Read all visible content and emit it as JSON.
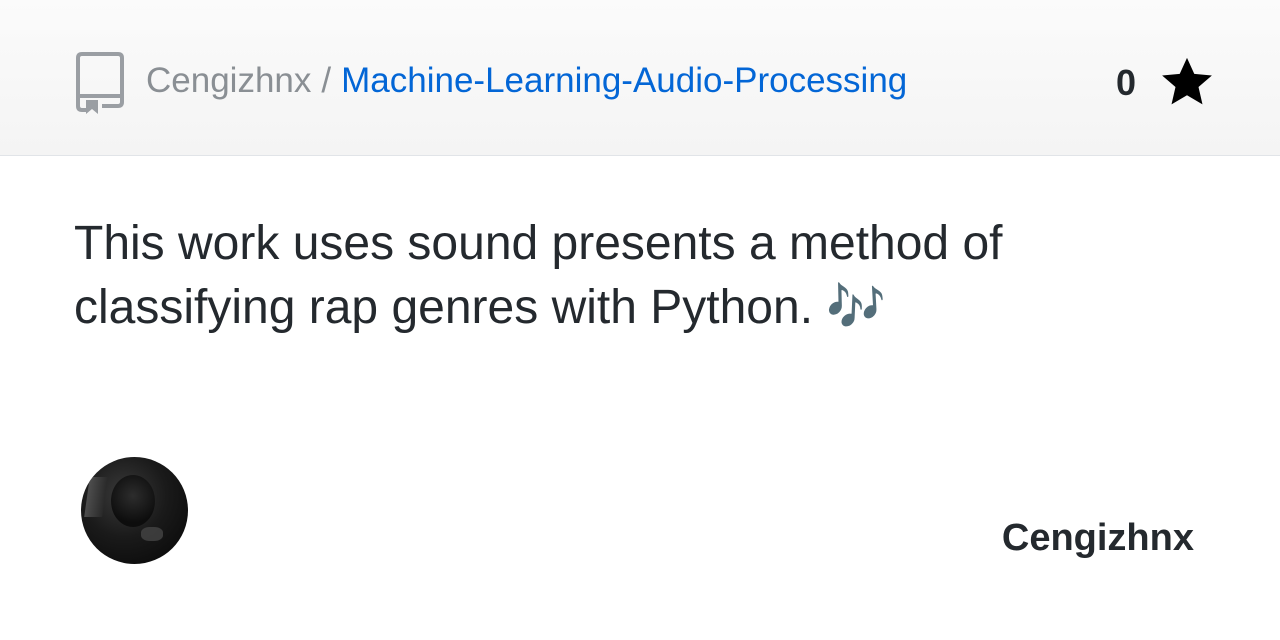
{
  "header": {
    "owner": "Cengizhnx",
    "separator": "/",
    "repo_name": "Machine-Learning-Audio-Processing",
    "star_count": "0",
    "repo_icon": "repo-icon",
    "star_icon": "star-icon"
  },
  "description": "This work uses sound presents a method of classifying rap genres with Python. 🎶",
  "footer": {
    "username": "Cengizhnx",
    "avatar_icon": "avatar"
  },
  "colors": {
    "link": "#0366d6",
    "muted": "#8a8f94",
    "text": "#24292e",
    "header_bg": "#f6f8fa"
  }
}
